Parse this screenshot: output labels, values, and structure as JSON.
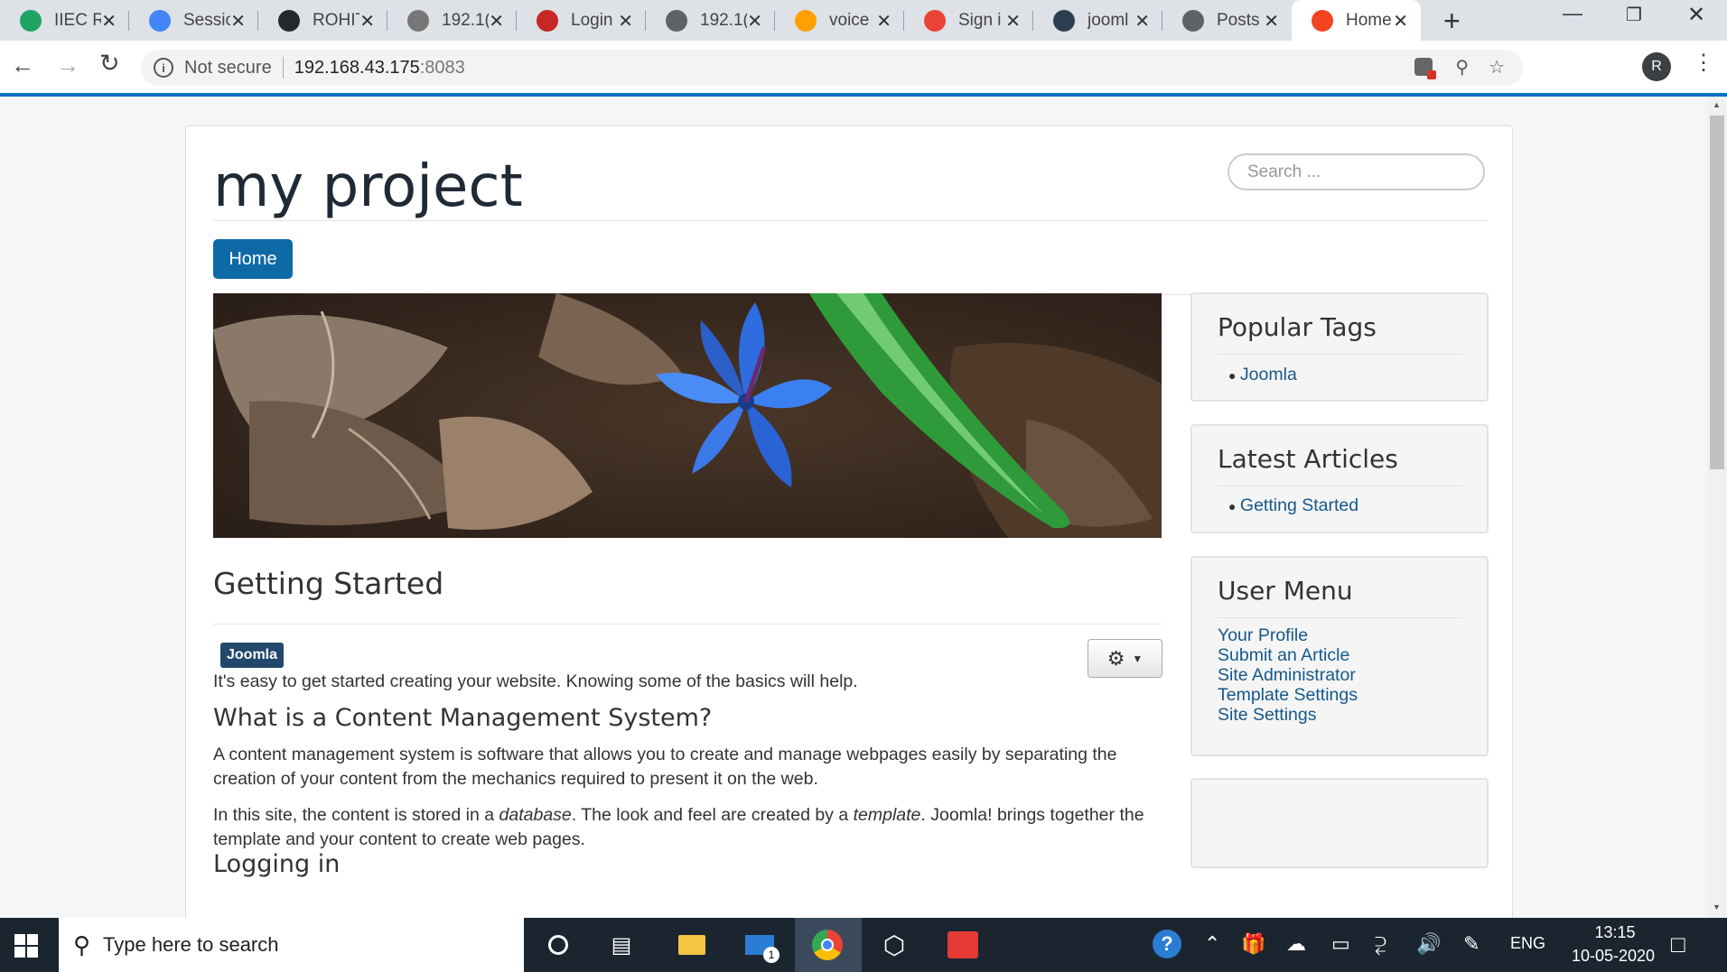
{
  "browser": {
    "tabs": [
      {
        "title": "IIEC R",
        "icon": "google-drive-icon",
        "color": "#1fa463"
      },
      {
        "title": "Sessio",
        "icon": "google-docs-icon",
        "color": "#4285f4"
      },
      {
        "title": "ROHIT",
        "icon": "github-icon",
        "color": "#24292e"
      },
      {
        "title": "192.1(",
        "icon": "user-avatar-icon",
        "color": "#777777"
      },
      {
        "title": "Login",
        "icon": "grid-app-icon",
        "color": "#c62828"
      },
      {
        "title": "192.1(",
        "icon": "globe-icon",
        "color": "#5f6368"
      },
      {
        "title": "voice",
        "icon": "flame-icon",
        "color": "#ffa000"
      },
      {
        "title": "Sign i",
        "icon": "google-icon",
        "color": "#ea4335"
      },
      {
        "title": "jooml",
        "icon": "docker-icon",
        "color": "#2d3e50"
      },
      {
        "title": "Posts",
        "icon": "globe-icon",
        "color": "#5f6368"
      },
      {
        "title": "Home",
        "icon": "joomla-icon",
        "color": "#f44321",
        "active": true
      }
    ],
    "new_tab": "+",
    "security_label": "Not secure",
    "url": "192.168.43.175",
    "url_port": ":8083",
    "profile_initial": "R"
  },
  "site": {
    "title": "my project",
    "search_placeholder": "Search ...",
    "nav": {
      "home": "Home"
    }
  },
  "article": {
    "title": "Getting Started",
    "tag": "Joomla",
    "intro": "It's easy to get started creating your website. Knowing some of the basics will help.",
    "h_cms": "What is a Content Management System?",
    "p_cms": "A content management system is software that allows you to create and manage webpages easily by separating the creation of your content from the mechanics required to present it on the web.",
    "p_site_1": "In this site, the content is stored in a ",
    "p_site_em1": "database",
    "p_site_2": ". The look and feel are created by a ",
    "p_site_em2": "template",
    "p_site_3": ". Joomla! brings together the template and your content to create web pages.",
    "h_login": "Logging in"
  },
  "sidebar": {
    "popular_tags": {
      "title": "Popular Tags",
      "items": [
        "Joomla"
      ]
    },
    "latest_articles": {
      "title": "Latest Articles",
      "items": [
        "Getting Started"
      ]
    },
    "user_menu": {
      "title": "User Menu",
      "items": [
        "Your Profile",
        "Submit an Article",
        "Site Administrator",
        "Template Settings",
        "Site Settings"
      ]
    }
  },
  "taskbar": {
    "search_placeholder": "Type here to search",
    "mail_badge": "1",
    "language": "ENG",
    "time": "13:15",
    "date": "10-05-2020"
  },
  "colors": {
    "accent": "#0e6aa6",
    "link": "#15598c",
    "tag_badge": "#23486b"
  }
}
